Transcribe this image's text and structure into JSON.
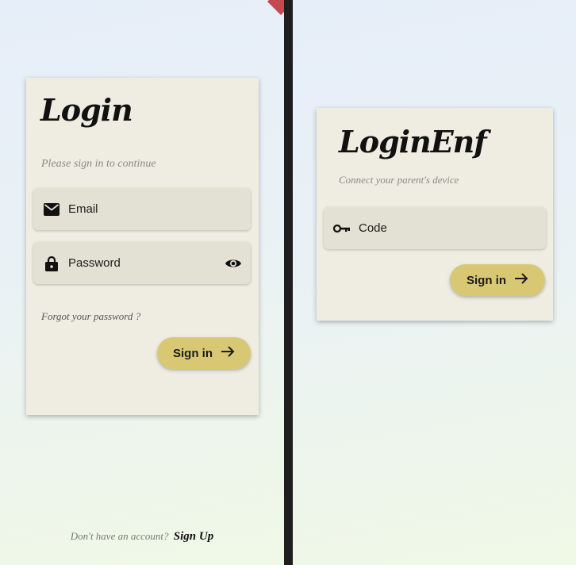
{
  "login_screen": {
    "title": "Login",
    "subtitle": "Please sign in to continue",
    "email_label": "Email",
    "password_label": "Password",
    "forgot_password": "Forgot your password ?",
    "signin_label": "Sign in",
    "no_account_text": "Don't have an account?",
    "signup_label": "Sign Up"
  },
  "child_screen": {
    "title": "LoginEnf",
    "subtitle": "Connect your parent's device",
    "code_label": "Code",
    "signin_label": "Sign in"
  },
  "icons": {
    "email": "mail-icon",
    "password": "lock-icon",
    "visibility": "eye-icon",
    "code": "key-icon",
    "arrow": "arrow-right-icon"
  },
  "colors": {
    "card": "#efede2",
    "field": "#e3e0d4",
    "button": "#d8c874",
    "ribbon": "#c4484f"
  }
}
